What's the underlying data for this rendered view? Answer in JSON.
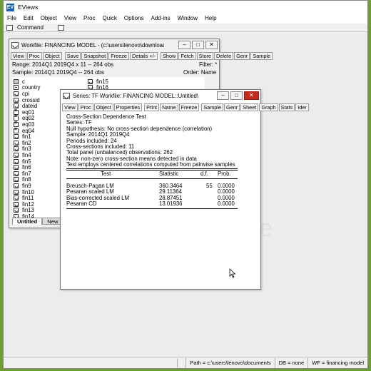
{
  "app": {
    "title": "EViews",
    "logo": "EV",
    "menu": [
      "File",
      "Edit",
      "Object",
      "View",
      "Proc",
      "Quick",
      "Options",
      "Add-ins",
      "Window",
      "Help"
    ],
    "command_label": "Command",
    "status": {
      "path": "Path = c:\\users\\lenovo\\documents",
      "db": "DB = none",
      "wf": "WF = financing model"
    },
    "bg_letter": "e"
  },
  "workfile": {
    "title": "Workfile: FINANCING MODEL - (c:\\users\\lenovo\\downloads\\...",
    "toolbar": [
      "View",
      "Proc",
      "Object",
      "Save",
      "Snapshot",
      "Freeze",
      "Details +/-",
      "Show",
      "Fetch",
      "Store",
      "Delete",
      "Genr",
      "Sample"
    ],
    "range": "Range:  2014Q1 2019Q4 x 11   --   264 obs",
    "filter": "Filter: *",
    "sample": "Sample: 2014Q1 2019Q4   --   264 obs",
    "order": "Order: Name",
    "objects_col1": [
      {
        "name": "c",
        "icon": "coef"
      },
      {
        "name": "country",
        "icon": "text"
      },
      {
        "name": "cpi",
        "icon": "series"
      },
      {
        "name": "crossid",
        "icon": "series"
      },
      {
        "name": "dateid",
        "icon": "series"
      },
      {
        "name": "eq01",
        "icon": "eq"
      },
      {
        "name": "eq02",
        "icon": "eq"
      },
      {
        "name": "eq03",
        "icon": "eq"
      },
      {
        "name": "eq04",
        "icon": "eq"
      },
      {
        "name": "fin1",
        "icon": "series"
      },
      {
        "name": "fin2",
        "icon": "series"
      },
      {
        "name": "fin3",
        "icon": "series"
      },
      {
        "name": "fin4",
        "icon": "series"
      },
      {
        "name": "fin5",
        "icon": "series"
      },
      {
        "name": "fin6",
        "icon": "series"
      },
      {
        "name": "fin7",
        "icon": "series"
      },
      {
        "name": "fin8",
        "icon": "series"
      },
      {
        "name": "fin9",
        "icon": "series"
      },
      {
        "name": "fin10",
        "icon": "series"
      },
      {
        "name": "fin11",
        "icon": "series"
      },
      {
        "name": "fin12",
        "icon": "series"
      },
      {
        "name": "fin13",
        "icon": "series"
      },
      {
        "name": "fin14",
        "icon": "series"
      }
    ],
    "objects_col2": [
      {
        "name": "fin15",
        "icon": "series"
      },
      {
        "name": "fin16",
        "icon": "series"
      }
    ],
    "tabs": [
      "Untitled",
      "New"
    ]
  },
  "series_window": {
    "title": "Series: TF   Workfile: FINANCING MODEL::Untitled\\",
    "toolbar": [
      "View",
      "Proc",
      "Object",
      "Properties",
      "Print",
      "Name",
      "Freeze",
      "Sample",
      "Genr",
      "Sheet",
      "Graph",
      "Stats",
      "Ider"
    ],
    "header_lines": [
      "Cross-Section Dependence Test",
      "Series: TF",
      "Null hypothesis: No cross-section dependence (correlation)",
      "Sample: 2014Q1 2019Q4",
      "Periods included: 24",
      "Cross-sections included: 11",
      "Total panel (unbalanced) observations: 262",
      "Note: non-zero cross-section means detected in data",
      "Test employs centered correlations computed from pairwise samples"
    ],
    "columns": {
      "test": "Test",
      "stat": "Statistic",
      "df": "d.f.",
      "prob": "Prob."
    },
    "rows": [
      {
        "test": "Breusch-Pagan LM",
        "stat": "360.3464",
        "df": "55",
        "prob": "0.0000"
      },
      {
        "test": "Pesaran scaled LM",
        "stat": "29.11364",
        "df": "",
        "prob": "0.0000"
      },
      {
        "test": "Bias-corrected scaled LM",
        "stat": "28.87451",
        "df": "",
        "prob": "0.0000"
      },
      {
        "test": "Pesaran CD",
        "stat": "13.01936",
        "df": "",
        "prob": "0.0000"
      }
    ]
  }
}
